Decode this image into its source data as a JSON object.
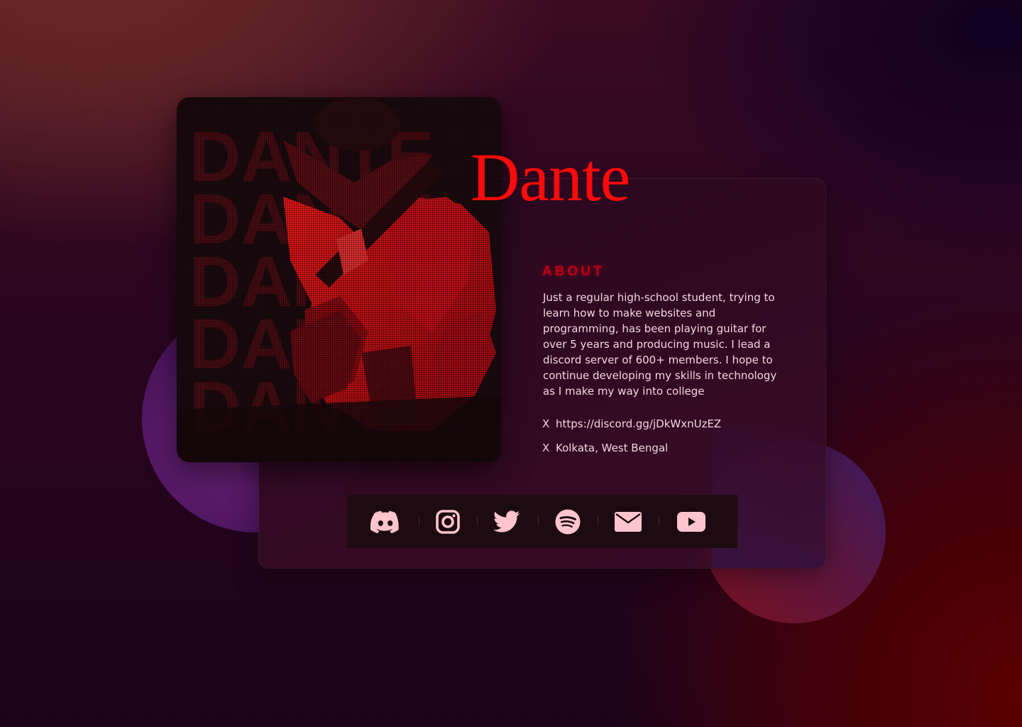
{
  "profile": {
    "name": "Dante",
    "photo_text": "DANTE"
  },
  "about": {
    "heading": "ABOUT",
    "body": "Just a regular high-school student, trying to learn how to make websites and programming, has been playing guitar for over 5 years and producing music. I lead a discord server of 600+ members. I hope to continue developing my skills in technology as I make my way into college"
  },
  "info": [
    {
      "marker": "X",
      "text": "https://discord.gg/jDkWxnUzEZ"
    },
    {
      "marker": "X",
      "text": "Kolkata, West Bengal"
    }
  ],
  "socials": [
    {
      "icon": "discord-icon"
    },
    {
      "icon": "instagram-icon"
    },
    {
      "icon": "twitter-icon"
    },
    {
      "icon": "spotify-icon"
    },
    {
      "icon": "mail-icon"
    },
    {
      "icon": "youtube-icon"
    }
  ],
  "colors": {
    "accent": "#ff0a0a",
    "about_heading": "#b80012",
    "icon": "#ffc4cc",
    "text": "#f1d7df",
    "social_bar": "#1c0c12"
  }
}
